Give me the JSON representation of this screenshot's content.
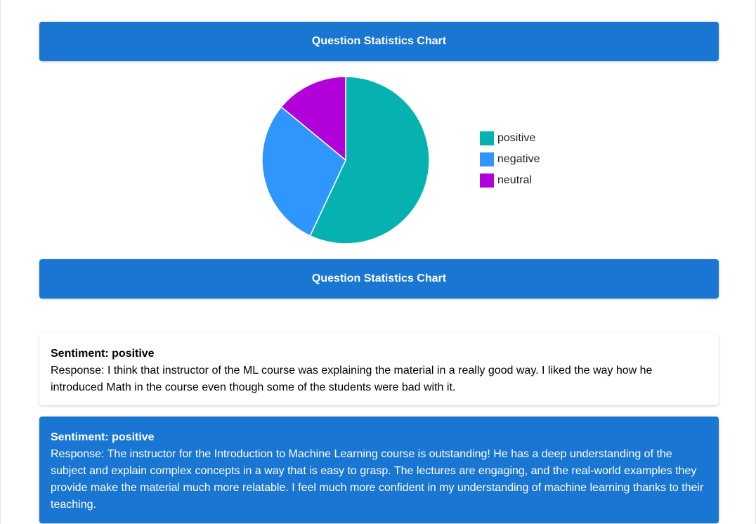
{
  "theme": {
    "primary": "#1976d2",
    "page_bg": "#ffffff"
  },
  "header_top": {
    "title": "Question Statistics Chart"
  },
  "header_bottom": {
    "title": "Question Statistics Chart"
  },
  "chart_data": {
    "type": "pie",
    "categories": [
      "positive",
      "negative",
      "neutral"
    ],
    "values": [
      57,
      29,
      14
    ],
    "colors": [
      "#05b2af",
      "#2e96fc",
      "#b100d8"
    ],
    "legend_position": "right",
    "title": ""
  },
  "legend": {
    "items": [
      {
        "label": "positive",
        "color": "#05b2af"
      },
      {
        "label": "negative",
        "color": "#2e96fc"
      },
      {
        "label": "neutral",
        "color": "#b100d8"
      }
    ]
  },
  "responses": [
    {
      "title": "Sentiment: positive",
      "text": "Response: I think that instructor of the ML course was explaining the material in a really good way. I liked the way how he introduced Math in the course even though some of the students were bad with it."
    },
    {
      "title": "Sentiment: positive",
      "text": "Response: The instructor for the Introduction to Machine Learning course is outstanding! He has a deep understanding of the subject and explain complex concepts in a way that is easy to grasp. The lectures are engaging, and the real-world examples they provide make the material much more relatable. I feel much more confident in my understanding of machine learning thanks to their teaching."
    }
  ]
}
